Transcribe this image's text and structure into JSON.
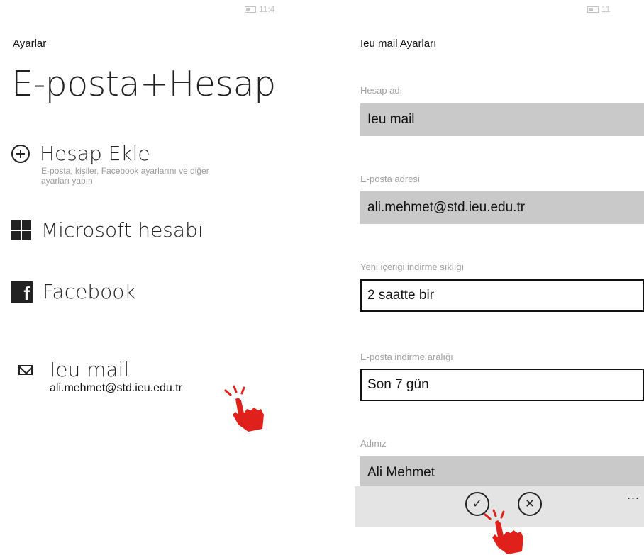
{
  "left": {
    "status": "11:4",
    "header": "Ayarlar",
    "title": "E-posta+Hesap",
    "items": [
      {
        "label": "Hesap Ekle",
        "sub": "E-posta, kişiler, Facebook ayarlarını ve diğer",
        "sub2": "ayarları yapın",
        "icon": "plus-circle-icon"
      },
      {
        "label": "Microsoft hesabı",
        "icon": "windows-icon"
      },
      {
        "label": "Facebook",
        "icon": "facebook-icon"
      },
      {
        "label": "Ieu mail",
        "email": "ali.mehmet@std.ieu.edu.tr",
        "icon": "envelope-icon"
      }
    ]
  },
  "right": {
    "status": "11",
    "header": "Ieu mail Ayarları",
    "fields": [
      {
        "label": "Hesap adı",
        "value": "Ieu mail"
      },
      {
        "label": "E-posta adresi",
        "value": "ali.mehmet@std.ieu.edu.tr"
      },
      {
        "label": "Yeni içeriği indirme sıklığı",
        "value": "2 saatte bir"
      },
      {
        "label": "E-posta indirme aralığı",
        "value": "Son 7 gün"
      },
      {
        "label": "Adınız",
        "value": "Ali Mehmet"
      }
    ],
    "appbar": {
      "confirm_icon": "✓",
      "cancel_icon": "✕",
      "more": "..."
    }
  },
  "colors": {
    "field_fill": "#c9c9c9",
    "tap_hand": "#e0201b"
  }
}
